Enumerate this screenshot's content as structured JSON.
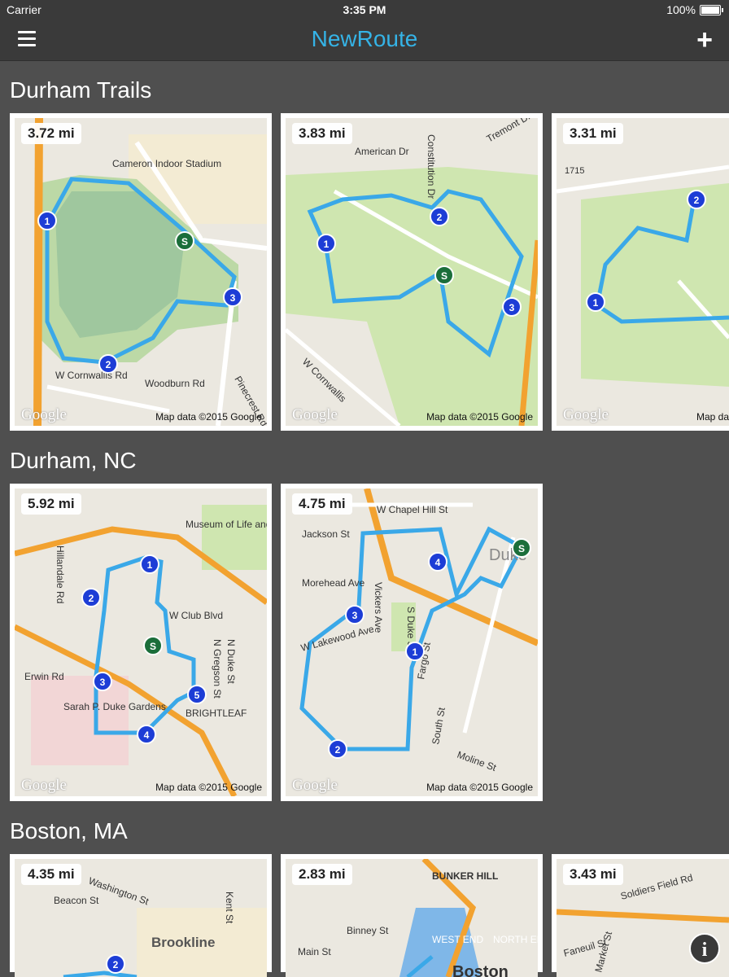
{
  "status": {
    "carrier": "Carrier",
    "time": "3:35 PM",
    "battery": "100%"
  },
  "nav": {
    "title": "NewRoute",
    "menu_icon": "hamburger-icon",
    "add_icon": "plus-icon",
    "add_label": "+"
  },
  "colors": {
    "accent": "#35b3e6",
    "route": "#3aa8e8",
    "marker_blue": "#1d3dd6",
    "marker_start": "#1b6e3a",
    "map_green": "#cfe6b0",
    "map_bg": "#ebe8e0",
    "highway": "#f2a230"
  },
  "sections": [
    {
      "title": "Durham Trails",
      "cards": [
        {
          "distance": "3.72 mi",
          "map_data": "Map data ©2015 Google",
          "google": "Google",
          "labels": [
            "Cameron Indoor Stadium",
            "Woodburn Rd",
            "W Cornwallis Rd",
            "Pinecrest Rd"
          ]
        },
        {
          "distance": "3.83 mi",
          "map_data": "Map data ©2015 Google",
          "google": "Google",
          "labels": [
            "American Dr",
            "Constitution Dr",
            "Tremont Dr",
            "W Cornwallis"
          ]
        },
        {
          "distance": "3.31 mi",
          "map_data": "Map da",
          "google": "Google",
          "labels": [
            "1715"
          ]
        }
      ]
    },
    {
      "title": "Durham, NC",
      "cards": [
        {
          "distance": "5.92 mi",
          "map_data": "Map data ©2015 Google",
          "google": "Google",
          "labels": [
            "Museum of Life and Science",
            "W Club Blvd",
            "Erwin Rd",
            "Sarah P. Duke Gardens",
            "BRIGHTLEAF",
            "Hillandale Rd",
            "N Duke St",
            "N Gregson St"
          ]
        },
        {
          "distance": "4.75 mi",
          "map_data": "Map data ©2015 Google",
          "google": "Google",
          "labels": [
            "W Chapel Hill St",
            "Jackson St",
            "Morehead Ave",
            "W Lakewood Ave",
            "Vickers Ave",
            "S Duke St",
            "Fargo St",
            "South St",
            "Moline St",
            "Duke"
          ]
        }
      ]
    },
    {
      "title": "Boston, MA",
      "cards": [
        {
          "distance": "4.35 mi",
          "map_data": "",
          "google": "",
          "labels": [
            "Washington St",
            "Beacon St",
            "Brookline",
            "Kent St"
          ]
        },
        {
          "distance": "2.83 mi",
          "map_data": "",
          "google": "",
          "labels": [
            "BUNKER HILL",
            "Binney St",
            "WEST END",
            "NORTH END",
            "Main St",
            "Boston"
          ]
        },
        {
          "distance": "3.43 mi",
          "map_data": "",
          "google": "",
          "labels": [
            "Soldiers Field Rd",
            "Faneuil St",
            "Market St"
          ]
        }
      ]
    }
  ],
  "info_icon": "info-icon",
  "info_label": "i"
}
